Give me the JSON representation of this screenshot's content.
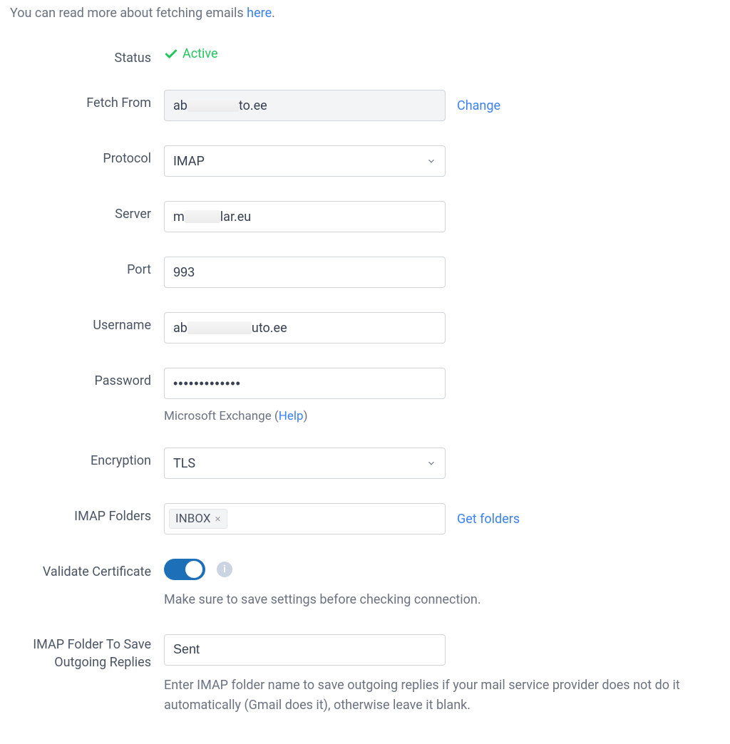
{
  "intro": {
    "text_before_link": "You can read more about fetching emails ",
    "link_text": "here",
    "after": "."
  },
  "labels": {
    "status": "Status",
    "fetch_from": "Fetch From",
    "protocol": "Protocol",
    "server": "Server",
    "port": "Port",
    "username": "Username",
    "password": "Password",
    "encryption": "Encryption",
    "imap_folders": "IMAP Folders",
    "validate_certificate": "Validate Certificate",
    "outgoing_folder_line1": "IMAP Folder To Save",
    "outgoing_folder_line2": "Outgoing Replies"
  },
  "status": {
    "text": "Active"
  },
  "fetch_from": {
    "prefix": "ab",
    "suffix": "to.ee",
    "change_label": "Change"
  },
  "protocol": {
    "value": "IMAP"
  },
  "server": {
    "prefix": "m",
    "suffix": "lar.eu"
  },
  "port": {
    "value": "993"
  },
  "username": {
    "prefix": "ab",
    "suffix": "uto.ee"
  },
  "password": {
    "masked": "•••••••••••••"
  },
  "password_help": {
    "prefix": "Microsoft Exchange (",
    "link": "Help",
    "suffix": ")"
  },
  "encryption": {
    "value": "TLS"
  },
  "imap_folders": {
    "tag": "INBOX",
    "get_folders": "Get folders"
  },
  "validate_certificate": {
    "on": true,
    "help": "Make sure to save settings before checking connection."
  },
  "outgoing_folder": {
    "value": "Sent",
    "help": "Enter IMAP folder name to save outgoing replies if your mail service provider does not do it automatically (Gmail does it), otherwise leave it blank."
  }
}
